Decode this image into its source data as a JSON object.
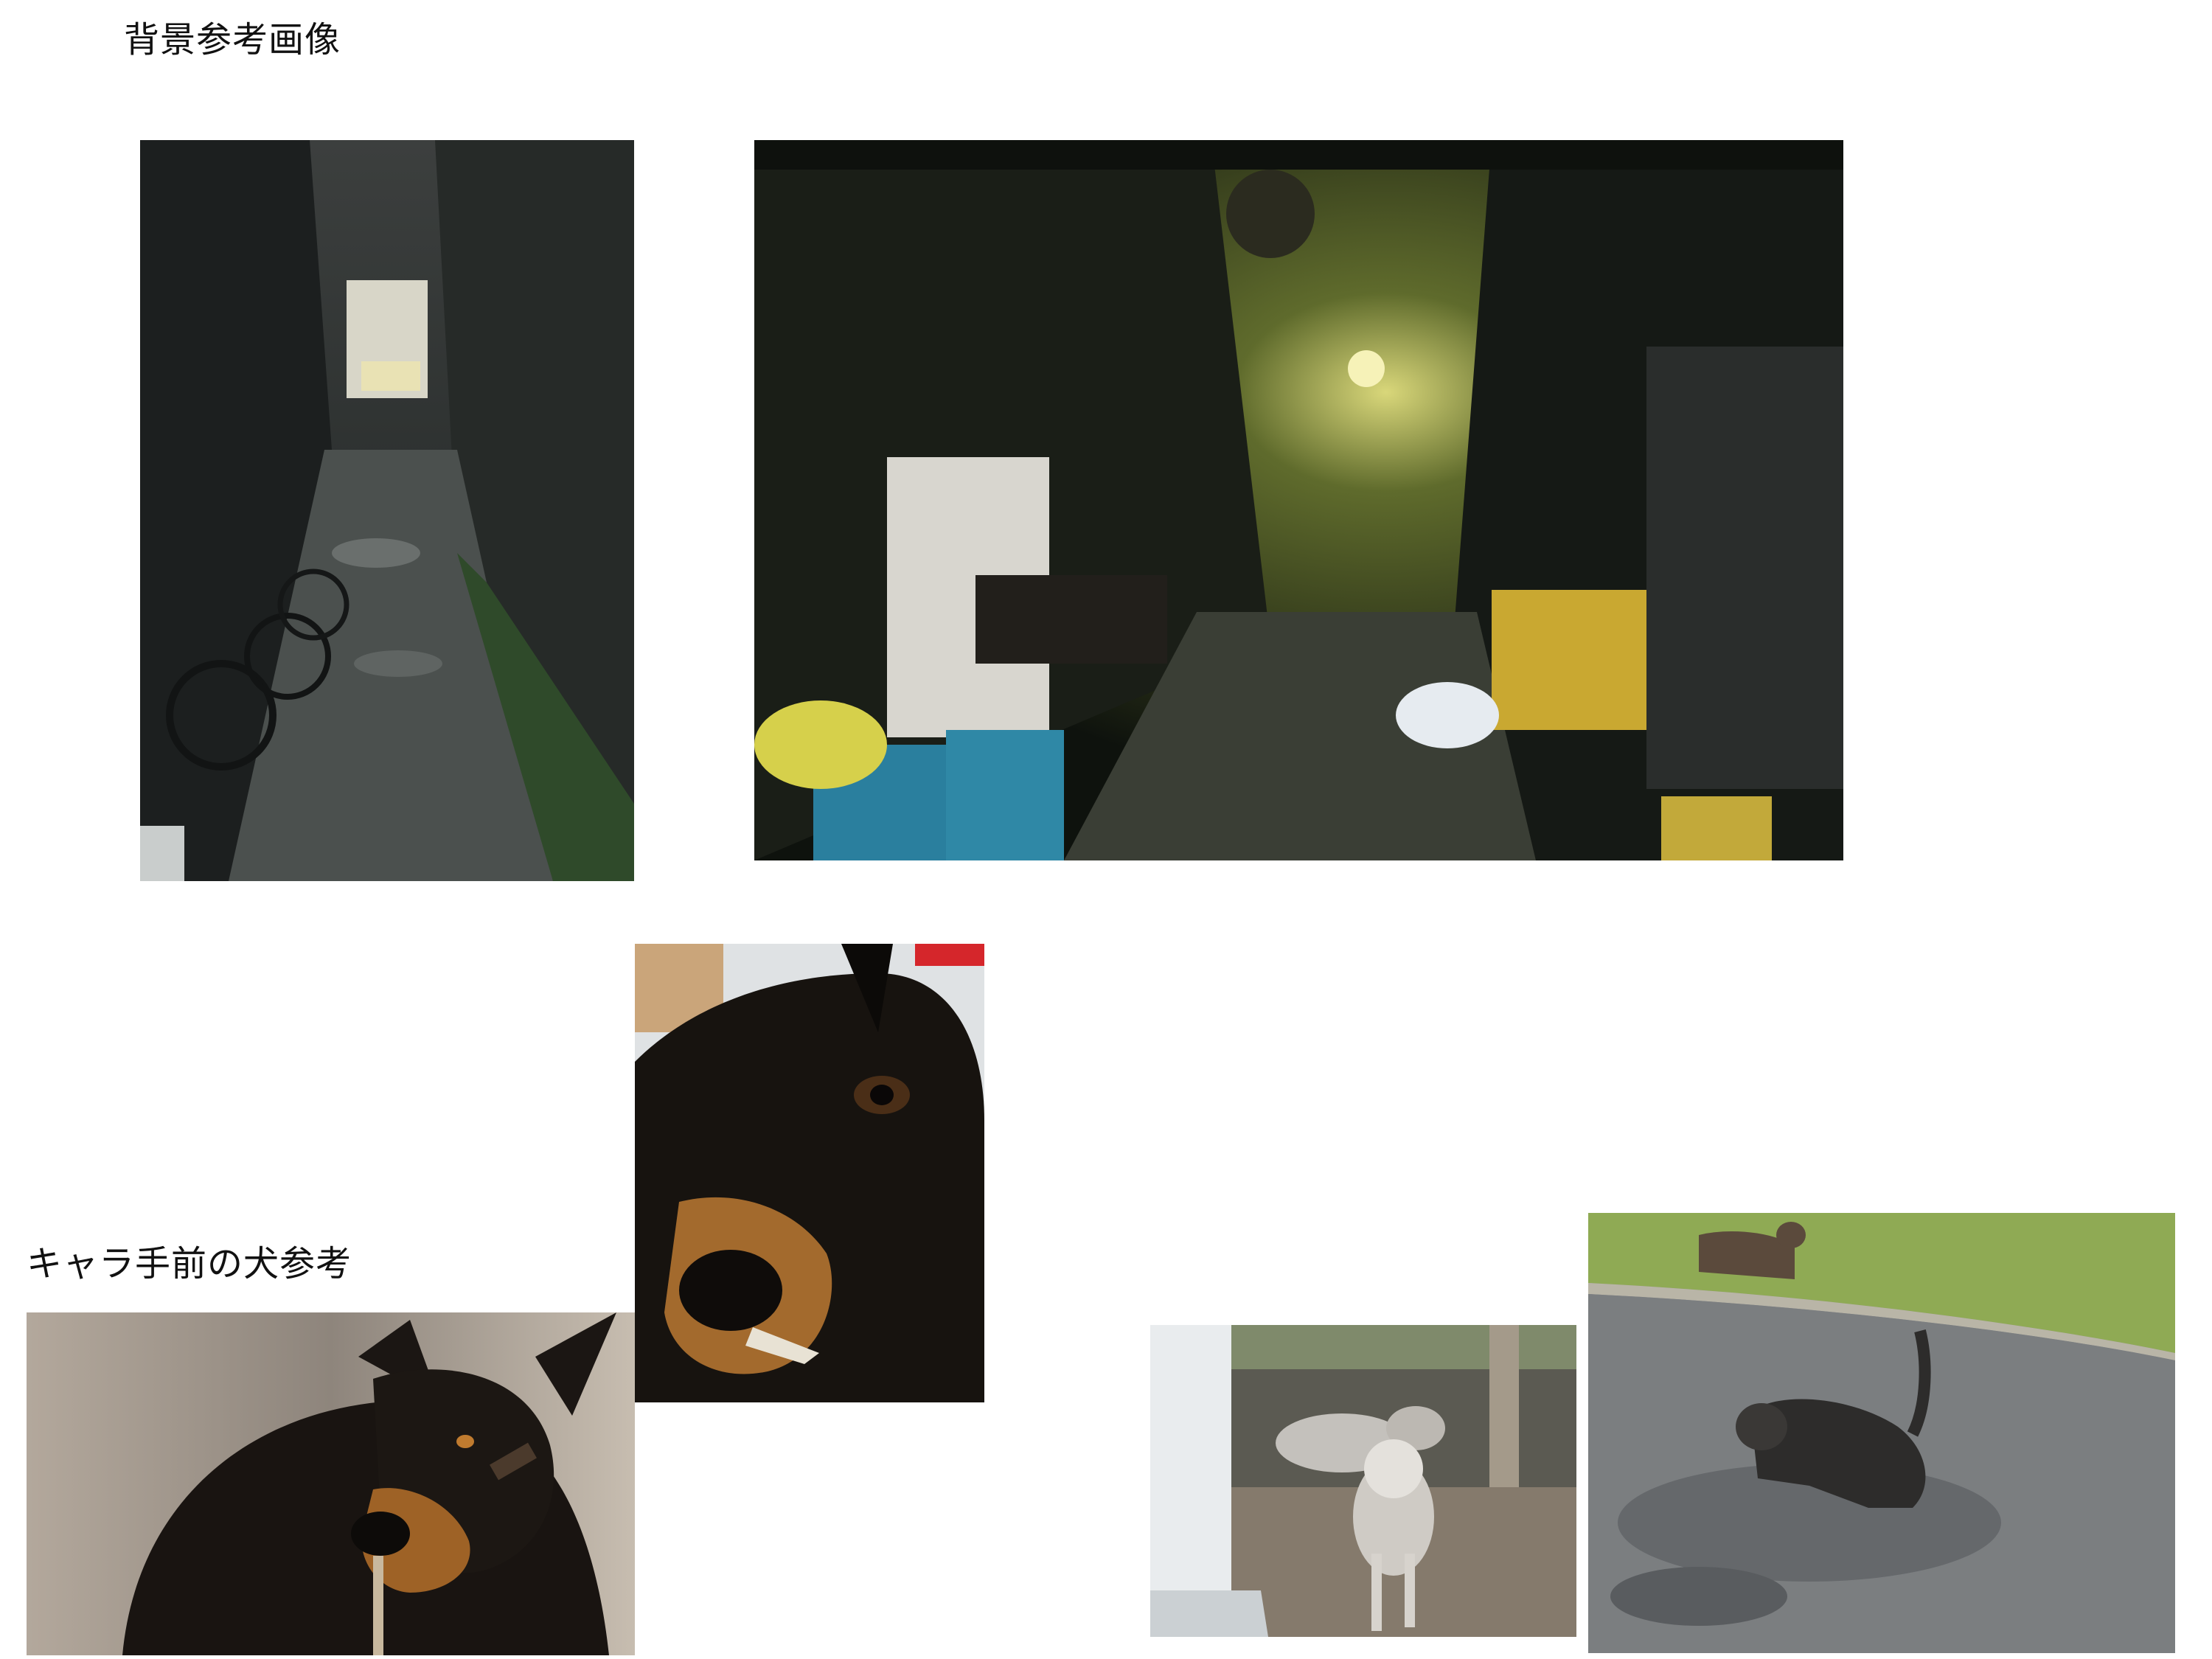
{
  "background_section": {
    "heading": "背景参考画像",
    "images": [
      {
        "name": "rainy-narrow-alley-photo",
        "subject": "wet narrow back alley with parked bicycles"
      },
      {
        "name": "night-market-alley-photo",
        "subject": "dark covered market alley with graffiti, bins and shutters"
      }
    ]
  },
  "dog_section": {
    "heading": "キャラ手前の犬参考",
    "images": [
      {
        "name": "doberman-closeup-photo",
        "subject": "doberman head close-up"
      },
      {
        "name": "doberman-standing-photo",
        "subject": "doberman standing"
      },
      {
        "name": "huskies-by-fence-photo",
        "subject": "two huskies near chain-link fence"
      },
      {
        "name": "dogs-on-road-photo",
        "subject": "brindle dog on wet road, another dog on grass"
      }
    ]
  },
  "colors": {
    "page_background": "#ffffff",
    "heading_text": "#111111"
  }
}
